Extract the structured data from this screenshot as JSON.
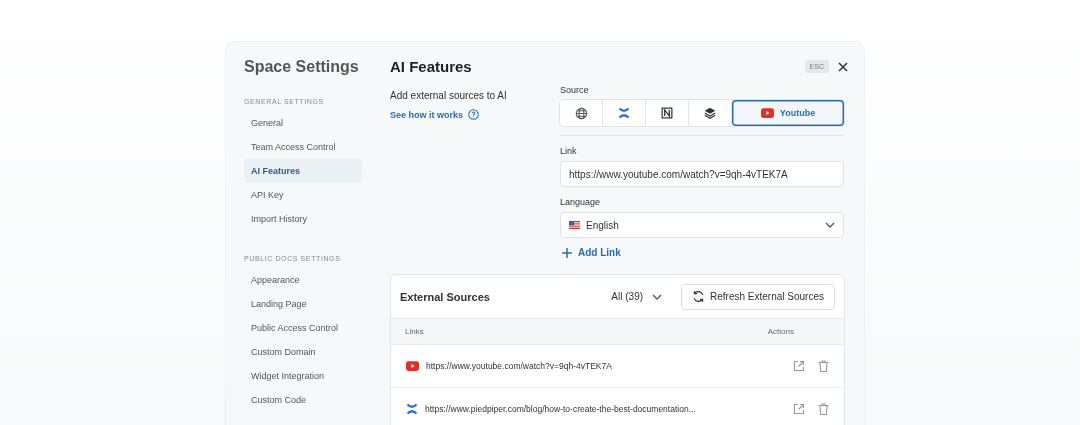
{
  "breadcrumb": {
    "parent": "Space Settings",
    "current": "AI Features"
  },
  "esc": "ESC",
  "sidebar": {
    "sections": [
      {
        "heading": "GENERAL SETTINGS",
        "items": [
          {
            "label": "General",
            "selected": false
          },
          {
            "label": "Team Access Control",
            "selected": false
          },
          {
            "label": "AI Features",
            "selected": true
          },
          {
            "label": "API Key",
            "selected": false
          },
          {
            "label": "Import History",
            "selected": false
          }
        ]
      },
      {
        "heading": "PUBLIC DOCS SETTINGS",
        "items": [
          {
            "label": "Appearance",
            "selected": false
          },
          {
            "label": "Landing Page",
            "selected": false
          },
          {
            "label": "Public Access Control",
            "selected": false
          },
          {
            "label": "Custom Domain",
            "selected": false
          },
          {
            "label": "Widget Integration",
            "selected": false
          },
          {
            "label": "Custom Code",
            "selected": false
          }
        ]
      }
    ]
  },
  "intro": {
    "text": "Add external sources to AI",
    "link": "See how it works"
  },
  "source": {
    "label": "Source",
    "options": [
      {
        "kind": "web",
        "selected": false
      },
      {
        "kind": "cross",
        "selected": false
      },
      {
        "kind": "notion",
        "selected": false
      },
      {
        "kind": "stack",
        "selected": false
      },
      {
        "kind": "youtube",
        "label": "Youtube",
        "selected": true
      }
    ]
  },
  "link_field": {
    "label": "Link",
    "value": "https://www.youtube.com/watch?v=9qh-4vTEK7A"
  },
  "language": {
    "label": "Language",
    "value": "English"
  },
  "add_link": "Add Link",
  "external_sources": {
    "title": "External Sources",
    "filter": "All (39)",
    "refresh": "Refresh External Sources",
    "columns": [
      "Links",
      "Actions"
    ],
    "rows": [
      {
        "kind": "youtube",
        "url": "https://www.youtube.com/watch?v=9qh-4vTEK7A"
      },
      {
        "kind": "cross",
        "url": "https://www.piedpiper.com/blog/how-to-create-the-best-documentation..."
      }
    ]
  }
}
